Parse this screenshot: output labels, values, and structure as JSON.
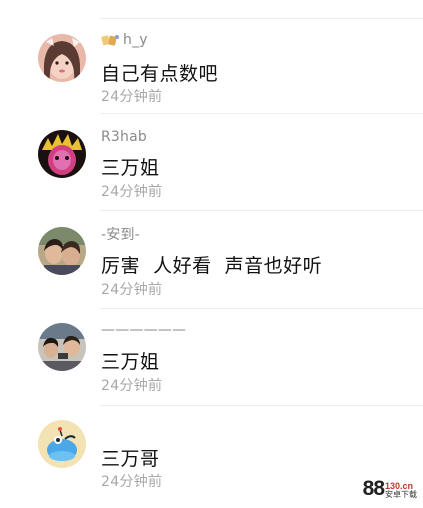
{
  "comments": [
    {
      "username": "h_y",
      "text": "自己有点数吧",
      "time": "24分钟前",
      "has_badge": true
    },
    {
      "username": "R3hab",
      "text": "三万姐",
      "time": "24分钟前",
      "has_badge": false
    },
    {
      "username": "-安到-",
      "text": "厉害  人好看  声音也好听",
      "time": "24分钟前",
      "has_badge": false
    },
    {
      "username": "——————",
      "text": "三万姐",
      "time": "24分钟前",
      "has_badge": false
    },
    {
      "username": "",
      "text": "三万哥",
      "time": "24分钟前",
      "has_badge": false
    }
  ],
  "watermark": {
    "number": "88",
    "top": "130.cn",
    "bottom": "安卓下载"
  },
  "colors": {
    "username": "#8a8a8a",
    "text": "#111111",
    "time": "#a8a8a8",
    "divider": "#eeeeee"
  }
}
